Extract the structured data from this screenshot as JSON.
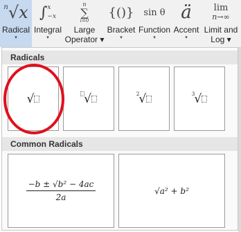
{
  "ribbon": {
    "buttons": [
      {
        "label_1": "Radical",
        "label_2": "▾"
      },
      {
        "label_1": "Integral",
        "label_2": "▾"
      },
      {
        "label_1": "Large",
        "label_2": "Operator ▾"
      },
      {
        "label_1": "Bracket",
        "label_2": "▾"
      },
      {
        "label_1": "Function",
        "label_2": "▾"
      },
      {
        "label_1": "Accent",
        "label_2": "▾"
      },
      {
        "label_1": "Limit and",
        "label_2": "Log ▾"
      }
    ],
    "icons": {
      "radical_index": "n",
      "radical_body": "√x",
      "integral_sign": "∫",
      "integral_upper": "x",
      "integral_lower": "−x",
      "sum_sign": "∑",
      "sum_upper": "n",
      "sum_lower": "i=0",
      "bracket": "{()}",
      "function": "sin θ",
      "accent": "ä",
      "limit_top": "lim",
      "limit_bottom": "n→∞"
    }
  },
  "dropdown": {
    "radicals_header": "Radicals",
    "common_header": "Common Radicals",
    "tiles": {
      "index_2": "2",
      "index_3": "3",
      "radical_sign": "√"
    },
    "quadratic": {
      "numerator": "−b ± √b² − 4ac",
      "denominator": "2a"
    },
    "pythagorean": "√a² + b²"
  },
  "colors": {
    "active_button": "#c6d9ef",
    "highlight_circle": "#e0101c"
  }
}
